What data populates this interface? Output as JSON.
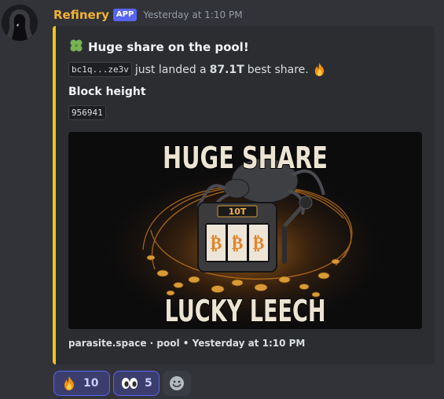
{
  "message": {
    "author": "Refinery",
    "badge": "APP",
    "timestamp": "Yesterday at 1:10 PM"
  },
  "embed": {
    "accent_color": "#f0c419",
    "title_emoji": "four-leaf-clover",
    "title": "Huge share on the pool!",
    "address": "bc1q...ze3v",
    "desc_text": "just landed a",
    "share_value": "87.1T",
    "desc_suffix": "best share.",
    "field_name": "Block height",
    "field_value": "956941",
    "image": {
      "top_text": "HUGE SHARE",
      "bottom_text": "LUCKY LEECH",
      "slot_label": "10T",
      "reels": [
        "₿",
        "₿",
        "₿"
      ]
    },
    "footer": "parasite.space · pool • Yesterday at 1:10 PM"
  },
  "reactions": [
    {
      "emoji": "fire",
      "count": "10"
    },
    {
      "emoji": "eyes",
      "count": "5"
    }
  ],
  "colors": {
    "brand": "#5865f2",
    "username": "#f0b232",
    "background": "#323339"
  }
}
